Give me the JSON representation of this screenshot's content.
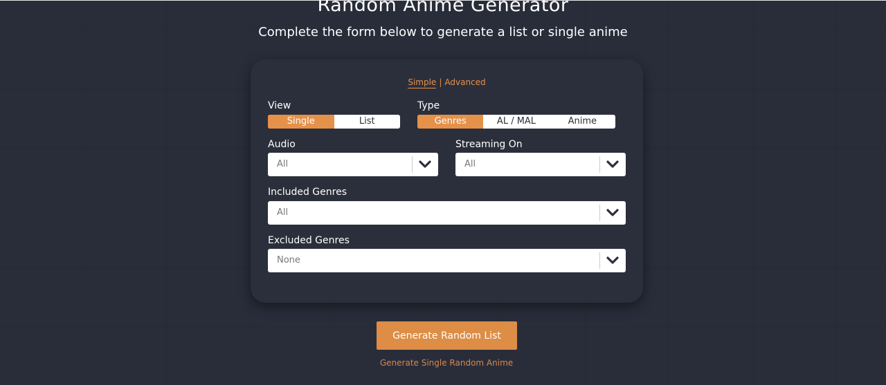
{
  "header": {
    "title": "Random Anime Generator",
    "subtitle": "Complete the form below to generate a list or single anime"
  },
  "mode": {
    "simple": "Simple",
    "separator": "|",
    "advanced": "Advanced",
    "selected": "Simple"
  },
  "view": {
    "label": "View",
    "options": [
      "Single",
      "List"
    ],
    "selected": "Single"
  },
  "type": {
    "label": "Type",
    "options": [
      "Genres",
      "AL / MAL",
      "Anime"
    ],
    "selected": "Genres"
  },
  "audio": {
    "label": "Audio",
    "value": "All"
  },
  "streaming": {
    "label": "Streaming On",
    "value": "All"
  },
  "included": {
    "label": "Included Genres",
    "value": "All"
  },
  "excluded": {
    "label": "Excluded Genres",
    "value": "None"
  },
  "actions": {
    "primary": "Generate Random List",
    "secondary": "Generate Single Random Anime"
  },
  "colors": {
    "accent": "#e5914a",
    "card": "#2b2f3b",
    "background": "#2c303d"
  }
}
